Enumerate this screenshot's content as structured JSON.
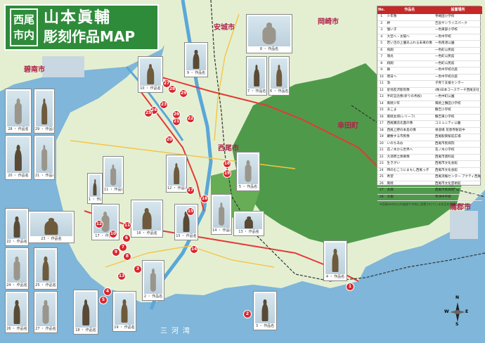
{
  "header": {
    "area_top": "西尾",
    "area_bottom": "市内",
    "title_line1": "山本眞輔",
    "title_line2": "彫刻作品MAP"
  },
  "map": {
    "cities": {
      "hekinan": "碧南市",
      "anjo": "安城市",
      "okazaki": "岡崎市",
      "nishio": "西尾市",
      "kota": "幸田町",
      "gamagori": "蒲郡市"
    },
    "bay": "三河湾",
    "colors": {
      "sea": "#7fb6d9",
      "land": "#e4efd2",
      "hill": "#4f9a4a",
      "road_major": "#e53935",
      "road_minor": "#f5c542",
      "rail": "#333333",
      "river": "#5aa7d8",
      "marker": "#d7262b"
    },
    "markers": [
      "1",
      "2",
      "3",
      "4",
      "5",
      "6",
      "7",
      "8",
      "9",
      "10",
      "11",
      "12",
      "13",
      "14",
      "15",
      "16",
      "17",
      "18",
      "19",
      "20",
      "21",
      "22",
      "23",
      "24",
      "25",
      "26",
      "27",
      "28",
      "29"
    ]
  },
  "photos": [
    {
      "caption": "28 ・ 作品名"
    },
    {
      "caption": "29 ・ 作品名"
    },
    {
      "caption": "20 ・ 作品名"
    },
    {
      "caption": "21 ・ 作品名"
    },
    {
      "caption": "22 ・ 作品名"
    },
    {
      "caption": "23 ・ 作品名"
    },
    {
      "caption": "24 ・ 作品名"
    },
    {
      "caption": "25 ・ 作品名"
    },
    {
      "caption": "26 ・ 作品名"
    },
    {
      "caption": "27 ・ 作品名"
    },
    {
      "caption": "18 ・ 作品名"
    },
    {
      "caption": "19 ・ 作品名"
    },
    {
      "caption": "17 ・ 作品名"
    },
    {
      "caption": "16 ・ 作品名"
    },
    {
      "caption": "15 ・ 作品名"
    },
    {
      "caption": "14 ・ 作品名"
    },
    {
      "caption": "13 ・ 作品名"
    },
    {
      "caption": "12 ・ 作品名"
    },
    {
      "caption": "11 ・ 作品名"
    },
    {
      "caption": "10 ・ 作品名"
    },
    {
      "caption": "9 ・ 作品名"
    },
    {
      "caption": "8 ・ 作品名"
    },
    {
      "caption": "7 ・ 作品名"
    },
    {
      "caption": "6 ・ 作品名"
    },
    {
      "caption": "5 ・ 作品名"
    },
    {
      "caption": "4 ・ 作品名"
    },
    {
      "caption": "3 ・ 作品名"
    },
    {
      "caption": "2 ・ 作品名"
    },
    {
      "caption": "1 ・ 作品名"
    }
  ],
  "legend": {
    "headers": [
      "No.",
      "作品名",
      "設置場所"
    ],
    "rows": [
      [
        "1",
        "少年像",
        "寺嶋田小学校"
      ],
      [
        "2",
        "絆",
        "吉良サンライズパーク"
      ],
      [
        "3",
        "憧い子",
        "一色東部小学校"
      ],
      [
        "4",
        "大空へ・太陽へ",
        "一色中学校"
      ],
      [
        "5",
        "若い活の上優あふれる未来の像",
        "一色南渚公園"
      ],
      [
        "6",
        "飛翔",
        "一色町公民館"
      ],
      [
        "7",
        "瑞光",
        "一色町公民館"
      ],
      [
        "8",
        "翔翔",
        "一色町公民館"
      ],
      [
        "9",
        "舞",
        "一色中学校の庭"
      ],
      [
        "10",
        "明日へ",
        "一色中学校の庭"
      ],
      [
        "11",
        "漁",
        "子育て支援センター"
      ],
      [
        "12",
        "星地友沢彫刻像",
        "(株)日本コーステーチ西尾支社"
      ],
      [
        "13",
        "手町記念像(祈りの馬祝)",
        "一色中町公園"
      ],
      [
        "14",
        "風暁少年",
        "風暁上鶴田小学校"
      ],
      [
        "15",
        "あこま",
        "鶴吉小学校"
      ],
      [
        "16",
        "風暁女郎(レリーフ)",
        "鶴吉東小学校"
      ],
      [
        "17",
        "西尾醸造北面の像",
        "コミュニティ公園"
      ],
      [
        "18",
        "西尾上野の本島の像",
        "果道場 花恵寺駅前中"
      ],
      [
        "19",
        "羅敷する市民像",
        "西尾駅東駅前広場"
      ],
      [
        "20",
        "いのちあお",
        "西尾市民病院"
      ],
      [
        "21",
        "花ノ木から世界へ",
        "花ノ木小学校"
      ],
      [
        "22",
        "大須原之衆慕像",
        "西尾市資料館"
      ],
      [
        "23",
        "生きがい",
        "西尾市文化会館"
      ],
      [
        "24",
        "時のむこうにまもし西尾っ子",
        "西尾市文化会館"
      ],
      [
        "25",
        "希望",
        "西尾消験センター アクティ西尾"
      ],
      [
        "26",
        "風暁",
        "西尾市文化芸術館"
      ],
      [
        "27",
        "太陽",
        "西尾市民病院"
      ],
      [
        "28",
        "大樹",
        "寺津中学校"
      ]
    ],
    "note": "※西尾市内の公共施設や学校に設置されている作品を掲載しています。"
  },
  "compass": {
    "n": "N",
    "s": "S",
    "e": "E",
    "w": "W"
  }
}
